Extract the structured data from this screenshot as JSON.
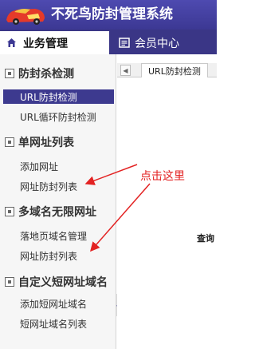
{
  "app": {
    "title": "不死鸟防封管理系统"
  },
  "tabs": [
    {
      "label": "业务管理",
      "icon": "home-icon"
    },
    {
      "label": "会员中心",
      "icon": "document-icon"
    }
  ],
  "sidebar": {
    "groups": [
      {
        "label": "防封杀检测",
        "items": [
          {
            "label": "URL防封检测",
            "active": true
          },
          {
            "label": "URL循环防封检测",
            "active": false
          }
        ]
      },
      {
        "label": "单网址列表",
        "items": [
          {
            "label": "添加网址",
            "active": false
          },
          {
            "label": "网址防封列表",
            "active": false
          }
        ]
      },
      {
        "label": "多域名无限网址",
        "items": [
          {
            "label": "落地页域名管理",
            "active": false
          },
          {
            "label": "网址防封列表",
            "active": false
          }
        ]
      },
      {
        "label": "自定义短网址域名",
        "items": [
          {
            "label": "添加短网址域名",
            "active": false
          },
          {
            "label": "短网址域名列表",
            "active": false
          }
        ]
      }
    ]
  },
  "content": {
    "tab_label": "URL防封检测",
    "query_label": "查询"
  },
  "annotation": {
    "text": "点击这里",
    "color": "#e32222"
  },
  "colors": {
    "header": "#3c3893",
    "active_item": "#3d3a8f"
  }
}
